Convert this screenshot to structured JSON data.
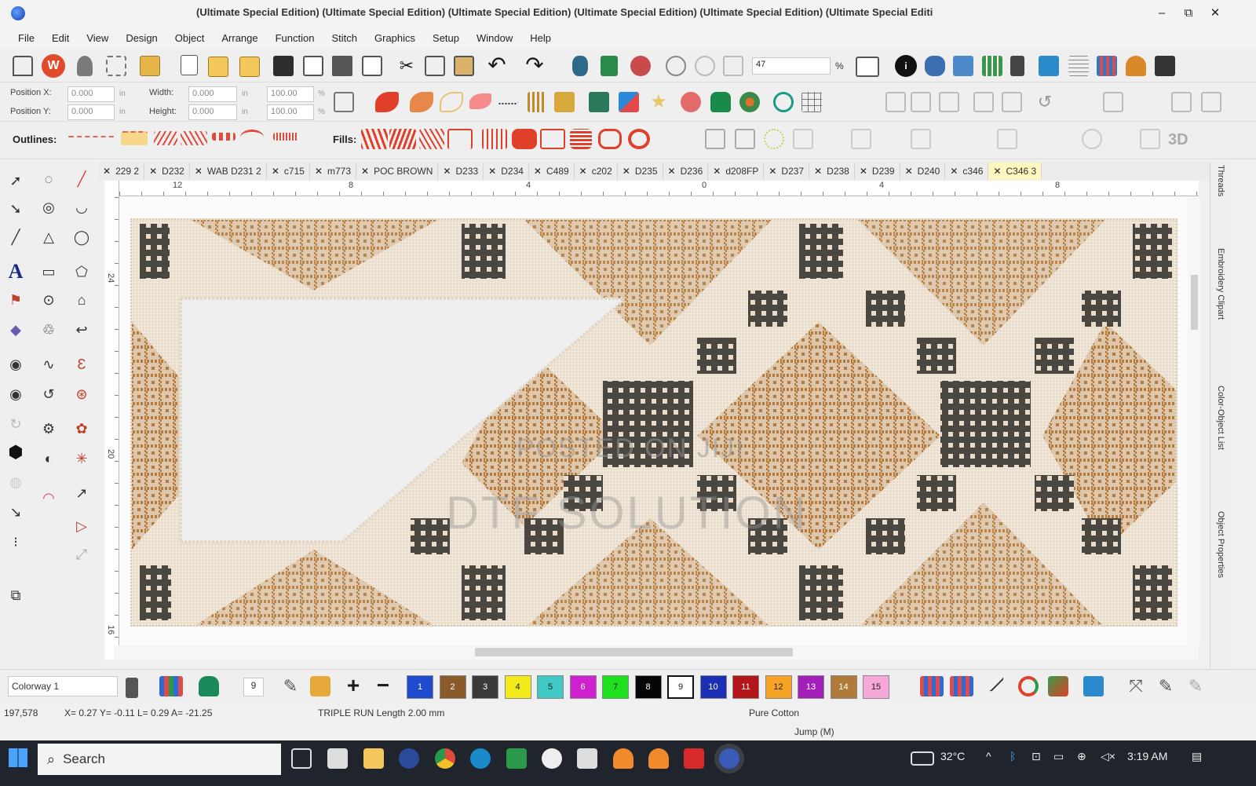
{
  "window": {
    "title": "(Ultimate Special Edition) (Ultimate Special Edition) (Ultimate Special Edition) (Ultimate Special Edition) (Ultimate Special Edition) (Ultimate Special Editi",
    "minimize": "–",
    "restore": "⧉",
    "close": "✕"
  },
  "menu": [
    "File",
    "Edit",
    "View",
    "Design",
    "Object",
    "Arrange",
    "Function",
    "Stitch",
    "Graphics",
    "Setup",
    "Window",
    "Help"
  ],
  "toolbar_main": {
    "zoom_value": "47",
    "zoom_unit": "%"
  },
  "position_panel": {
    "pos_x_label": "Position X:",
    "pos_x_value": "0.000",
    "pos_x_unit": "in",
    "pos_y_label": "Position Y:",
    "pos_y_value": "0.000",
    "pos_y_unit": "in",
    "width_label": "Width:",
    "width_value": "0.000",
    "width_unit": "in",
    "height_label": "Height:",
    "height_value": "0.000",
    "height_unit": "in",
    "scale_w": "100.00",
    "scale_h": "100.00",
    "scale_unit": "%"
  },
  "stitch_toolbar": {
    "outlines_label": "Outlines:",
    "fills_label": "Fills:",
    "three_d": "3D"
  },
  "tabs": [
    "229 2",
    "D232",
    "WAB D231 2",
    "c715",
    "m773",
    "POC BROWN",
    "D233",
    "D234",
    "C489",
    "c202",
    "D235",
    "D236",
    "d208FP",
    "D237",
    "D238",
    "D239",
    "D240",
    "c346",
    "C346 3"
  ],
  "tab_close": "✕",
  "ruler": {
    "h": [
      "12",
      "8",
      "4",
      "0",
      "4",
      "8"
    ],
    "v": [
      "24",
      "20",
      "16"
    ]
  },
  "watermark": {
    "line1": "POSTED ON JIJI",
    "line2": "DTF SOLUTION"
  },
  "right_dock": [
    "Threads",
    "Embroidery Clipart",
    "Color-Object List",
    "Object Properties"
  ],
  "colorway": {
    "label": "Colorway 1",
    "count": "9"
  },
  "swatches": [
    {
      "n": "1",
      "color": "#1f4bd0"
    },
    {
      "n": "2",
      "color": "#8b5a2b"
    },
    {
      "n": "3",
      "color": "#3a3a3a"
    },
    {
      "n": "4",
      "color": "#f2ea1b"
    },
    {
      "n": "5",
      "color": "#3fc8c4"
    },
    {
      "n": "6",
      "color": "#d021d0"
    },
    {
      "n": "7",
      "color": "#1ee01e"
    },
    {
      "n": "8",
      "color": "#050505"
    },
    {
      "n": "9",
      "color": "#ffffff"
    },
    {
      "n": "10",
      "color": "#1a2fb5"
    },
    {
      "n": "11",
      "color": "#b3151b"
    },
    {
      "n": "12",
      "color": "#f6a224"
    },
    {
      "n": "13",
      "color": "#a21eb8"
    },
    {
      "n": "14",
      "color": "#b07a3a"
    },
    {
      "n": "15",
      "color": "#f6a8d8"
    }
  ],
  "status": {
    "stitches": "197,578",
    "coords": "X= 0.27 Y= -0.11 L= 0.29 A= -21.25",
    "stitch_type": "TRIPLE RUN Length 2.00 mm",
    "thread": "Pure Cotton",
    "mode": "Jump (M)"
  },
  "taskbar": {
    "search": "Search",
    "weather": "32°C",
    "time": "3:19 AM"
  }
}
